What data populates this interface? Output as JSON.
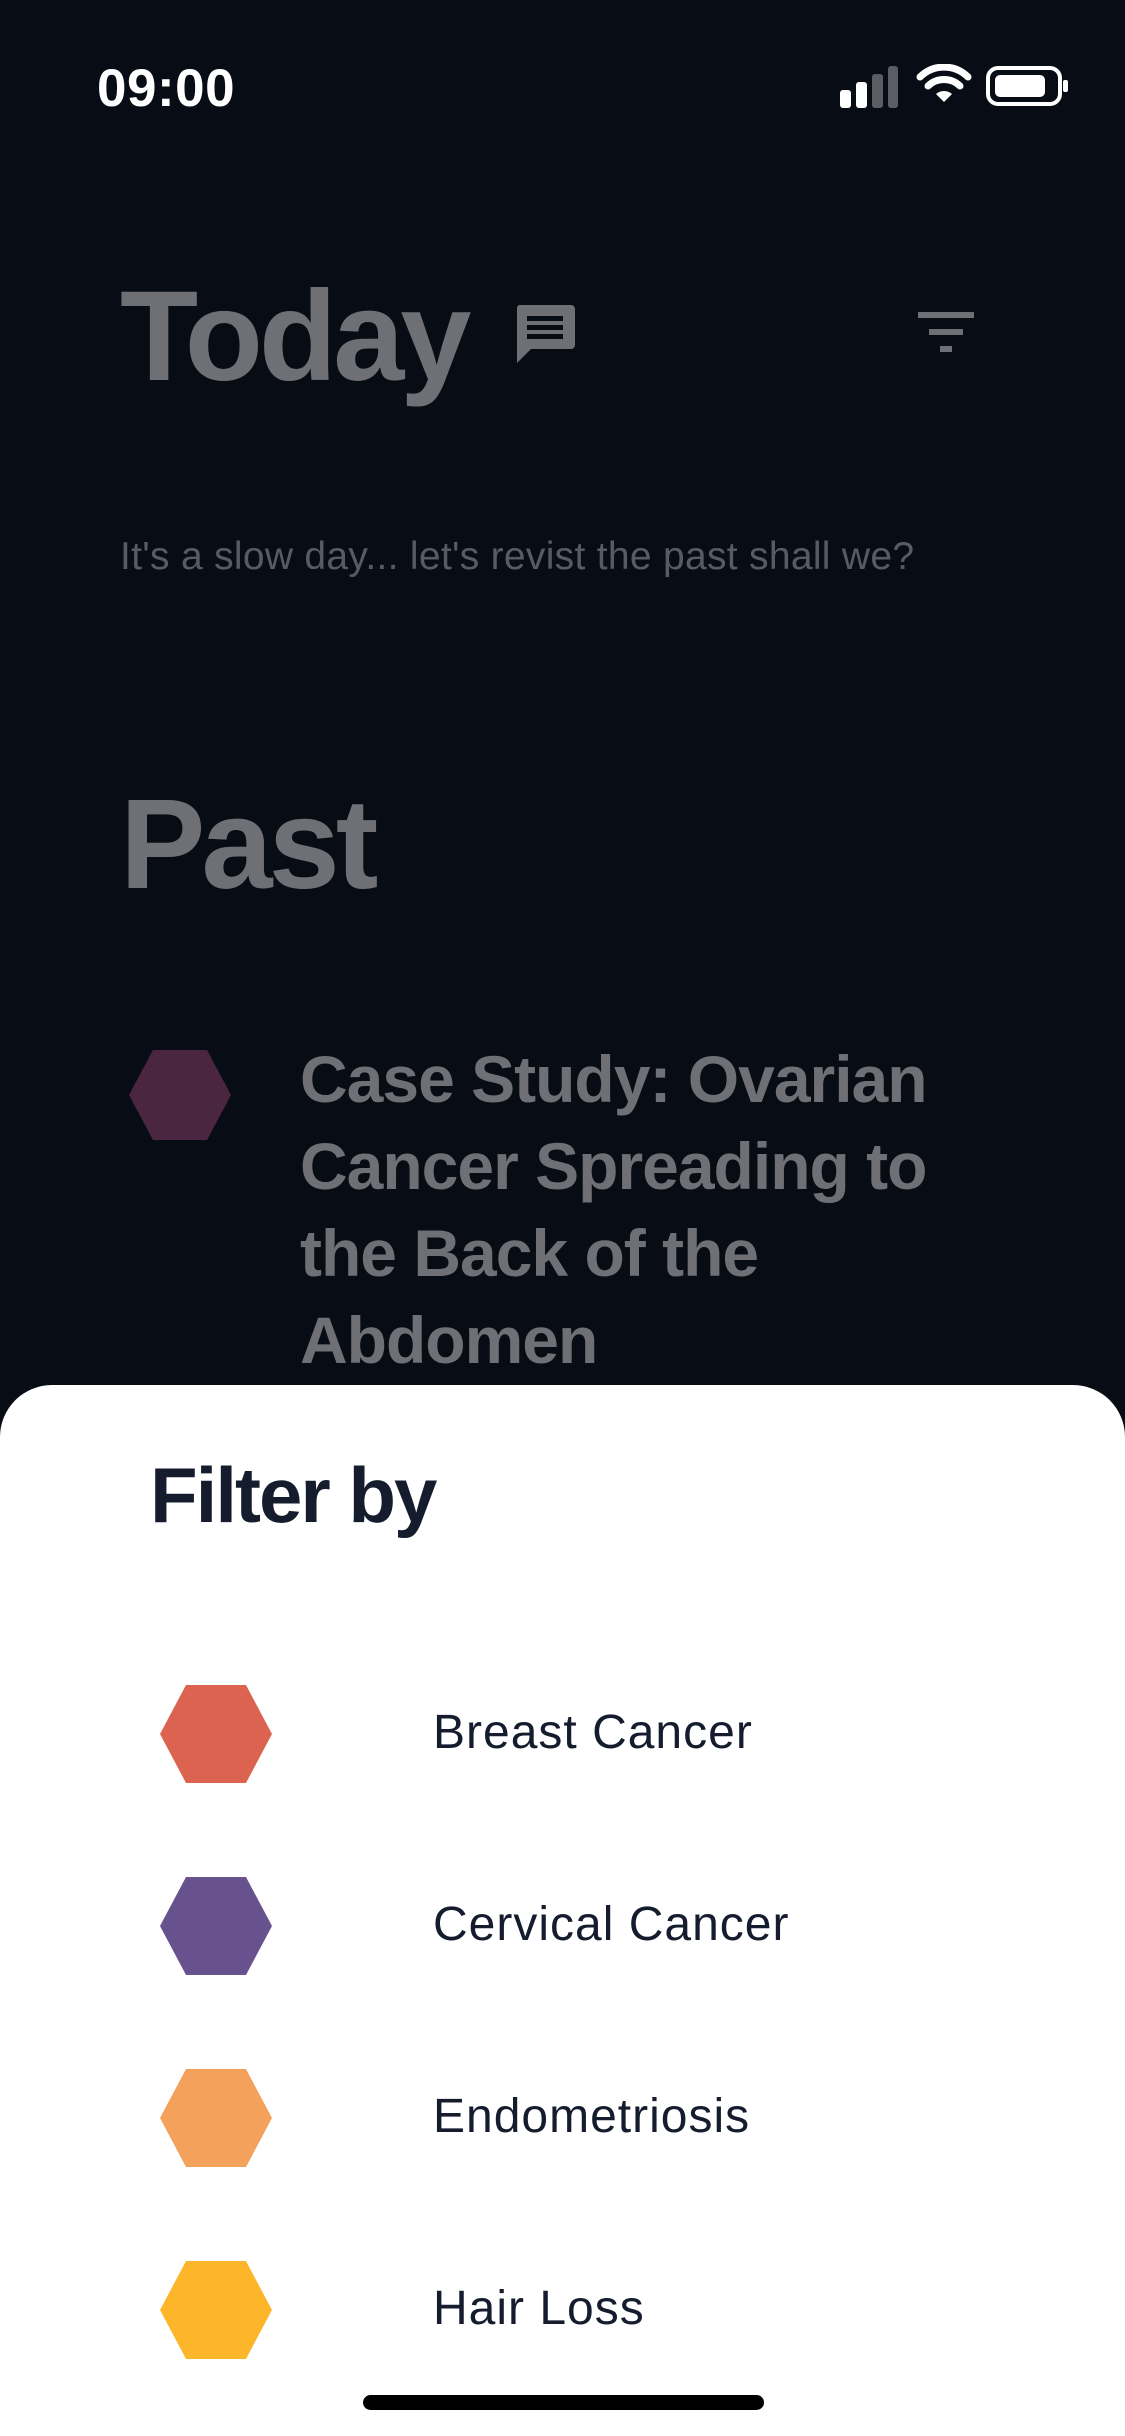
{
  "status_bar": {
    "time": "09:00"
  },
  "header": {
    "title": "Today",
    "subtitle": "It's a slow day... let's revist the past shall we?"
  },
  "past": {
    "title": "Past",
    "items": [
      {
        "title": "Case Study: Ovarian Cancer Spreading to the Back of the Abdomen",
        "color": "#4a2640"
      }
    ]
  },
  "filter_sheet": {
    "title": "Filter by",
    "options": [
      {
        "label": "Breast Cancer",
        "color": "#db6350"
      },
      {
        "label": "Cervical Cancer",
        "color": "#68528e"
      },
      {
        "label": "Endometriosis",
        "color": "#f3a15b"
      },
      {
        "label": "Hair Loss",
        "color": "#fdb62a"
      }
    ]
  }
}
